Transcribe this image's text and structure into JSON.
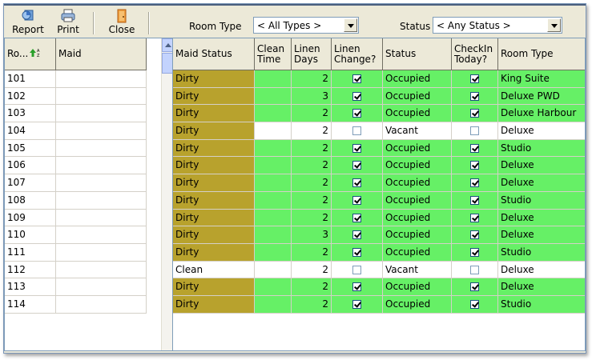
{
  "toolbar": {
    "report_label": "Report",
    "print_label": "Print",
    "close_label": "Close",
    "room_type_label": "Room Type",
    "room_type_value": "< All Types >",
    "status_label": "Status",
    "status_value": "< Any Status >"
  },
  "left_grid": {
    "headers": {
      "room": "Ro...",
      "maid": "Maid"
    },
    "sort_icon": "sort-ascending-icon"
  },
  "right_grid": {
    "headers": {
      "maid_status": "Maid Status",
      "clean_time": "Clean Time",
      "linen_days": "Linen Days",
      "linen_change": "Linen Change?",
      "status": "Status",
      "checkin_today": "CheckIn Today?",
      "room_type": "Room Type"
    }
  },
  "colors": {
    "dirty": "#b8a22d",
    "occupied_row": "#66f066",
    "vacant_row": "#ffffff"
  },
  "rows": [
    {
      "room": "101",
      "maid": "",
      "maid_status": "Dirty",
      "clean_time": "",
      "linen_days": "2",
      "linen_change": true,
      "status": "Occupied",
      "checkin_today": true,
      "room_type": "King Suite"
    },
    {
      "room": "102",
      "maid": "",
      "maid_status": "Dirty",
      "clean_time": "",
      "linen_days": "3",
      "linen_change": true,
      "status": "Occupied",
      "checkin_today": true,
      "room_type": "Deluxe PWD"
    },
    {
      "room": "103",
      "maid": "",
      "maid_status": "Dirty",
      "clean_time": "",
      "linen_days": "2",
      "linen_change": true,
      "status": "Occupied",
      "checkin_today": true,
      "room_type": "Deluxe Harbour"
    },
    {
      "room": "104",
      "maid": "",
      "maid_status": "Dirty",
      "clean_time": "",
      "linen_days": "2",
      "linen_change": false,
      "status": "Vacant",
      "checkin_today": false,
      "room_type": "Deluxe"
    },
    {
      "room": "105",
      "maid": "",
      "maid_status": "Dirty",
      "clean_time": "",
      "linen_days": "2",
      "linen_change": true,
      "status": "Occupied",
      "checkin_today": true,
      "room_type": "Studio"
    },
    {
      "room": "106",
      "maid": "",
      "maid_status": "Dirty",
      "clean_time": "",
      "linen_days": "2",
      "linen_change": true,
      "status": "Occupied",
      "checkin_today": true,
      "room_type": "Deluxe"
    },
    {
      "room": "107",
      "maid": "",
      "maid_status": "Dirty",
      "clean_time": "",
      "linen_days": "2",
      "linen_change": true,
      "status": "Occupied",
      "checkin_today": true,
      "room_type": "Deluxe"
    },
    {
      "room": "108",
      "maid": "",
      "maid_status": "Dirty",
      "clean_time": "",
      "linen_days": "2",
      "linen_change": true,
      "status": "Occupied",
      "checkin_today": true,
      "room_type": "Studio"
    },
    {
      "room": "109",
      "maid": "",
      "maid_status": "Dirty",
      "clean_time": "",
      "linen_days": "2",
      "linen_change": true,
      "status": "Occupied",
      "checkin_today": true,
      "room_type": "Deluxe"
    },
    {
      "room": "110",
      "maid": "",
      "maid_status": "Dirty",
      "clean_time": "",
      "linen_days": "3",
      "linen_change": true,
      "status": "Occupied",
      "checkin_today": true,
      "room_type": "Deluxe"
    },
    {
      "room": "111",
      "maid": "",
      "maid_status": "Dirty",
      "clean_time": "",
      "linen_days": "2",
      "linen_change": true,
      "status": "Occupied",
      "checkin_today": true,
      "room_type": "Studio"
    },
    {
      "room": "112",
      "maid": "",
      "maid_status": "Clean",
      "clean_time": "",
      "linen_days": "2",
      "linen_change": false,
      "status": "Vacant",
      "checkin_today": false,
      "room_type": "Deluxe"
    },
    {
      "room": "113",
      "maid": "",
      "maid_status": "Dirty",
      "clean_time": "",
      "linen_days": "2",
      "linen_change": true,
      "status": "Occupied",
      "checkin_today": true,
      "room_type": "Deluxe"
    },
    {
      "room": "114",
      "maid": "",
      "maid_status": "Dirty",
      "clean_time": "",
      "linen_days": "2",
      "linen_change": true,
      "status": "Occupied",
      "checkin_today": true,
      "room_type": "Studio"
    }
  ]
}
